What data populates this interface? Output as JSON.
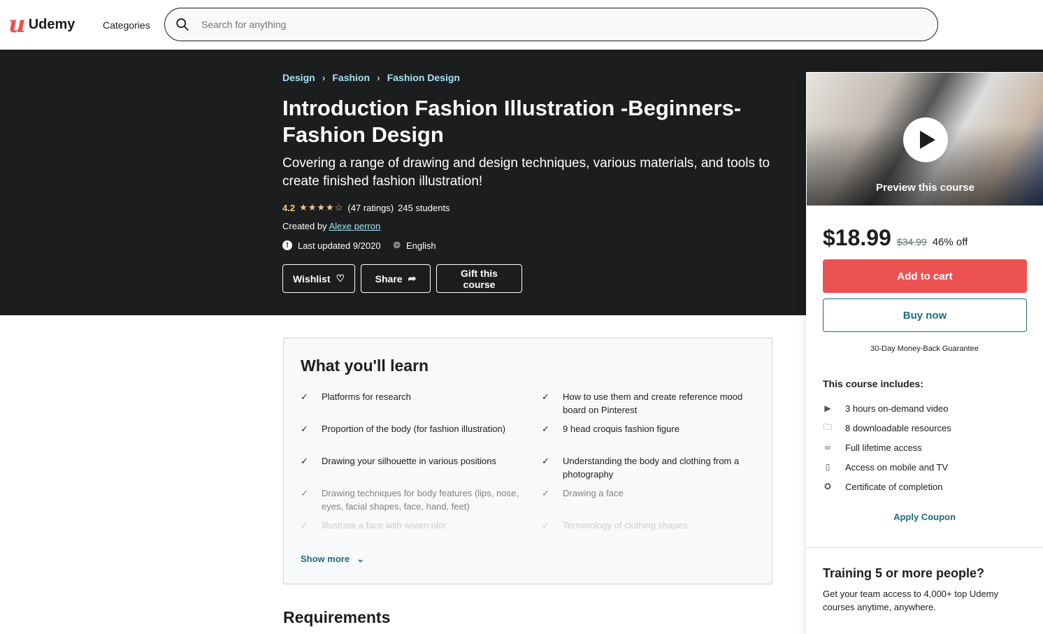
{
  "header": {
    "brand": "Udemy",
    "categories": "Categories",
    "search_placeholder": "Search for anything"
  },
  "breadcrumb": [
    "Design",
    "Fashion",
    "Fashion Design"
  ],
  "course": {
    "title": "Introduction Fashion Illustration -Beginners- Fashion Design",
    "subtitle": "Covering a range of drawing and design techniques, various materials, and tools to create finished fashion illustration!",
    "rating": "4.2",
    "stars": "★★★★☆",
    "ratings_count": "(47 ratings)",
    "students": "245 students",
    "created_by_label": "Created by",
    "author": "Alexe perron",
    "last_updated": "Last updated 9/2020",
    "language": "English"
  },
  "actions": {
    "wishlist": "Wishlist",
    "share": "Share",
    "gift": "Gift this course"
  },
  "sidebar": {
    "preview_label": "Preview this course",
    "price": "$18.99",
    "original_price": "$34.99",
    "discount": "46% off",
    "add_to_cart": "Add to cart",
    "buy_now": "Buy now",
    "guarantee": "30-Day Money-Back Guarantee",
    "includes_title": "This course includes:",
    "includes": [
      {
        "icon": "video-icon",
        "text": "3 hours on-demand video"
      },
      {
        "icon": "download-folder-icon",
        "text": "8 downloadable resources"
      },
      {
        "icon": "infinity-icon",
        "text": "Full lifetime access"
      },
      {
        "icon": "mobile-icon",
        "text": "Access on mobile and TV"
      },
      {
        "icon": "certificate-icon",
        "text": "Certificate of completion"
      }
    ],
    "apply_coupon": "Apply Coupon",
    "training_title": "Training 5 or more people?",
    "training_text": "Get your team access to 4,000+ top Udemy courses anytime, anywhere."
  },
  "learn": {
    "title": "What you'll learn",
    "items": [
      "Platforms for research",
      "How to use them and create reference mood board on Pinterest",
      "Proportion of the body (for fashion illustration)",
      "9 head croquis fashion figure",
      "Drawing your silhouette in various positions",
      "Understanding the body and clothing from a photography",
      "Drawing techniques for body features (lips, nose, eyes, facial shapes, face, hand, feet)",
      "Drawing a face",
      "Illustrate a face with watercolor",
      "Terminology of clothing shapes"
    ],
    "show_more": "Show more"
  },
  "requirements": {
    "title": "Requirements"
  },
  "colors": {
    "accent": "#ec5252",
    "link": "#1e6a84",
    "hero_bg": "#1c1d1f",
    "star": "#f3ca8c"
  }
}
